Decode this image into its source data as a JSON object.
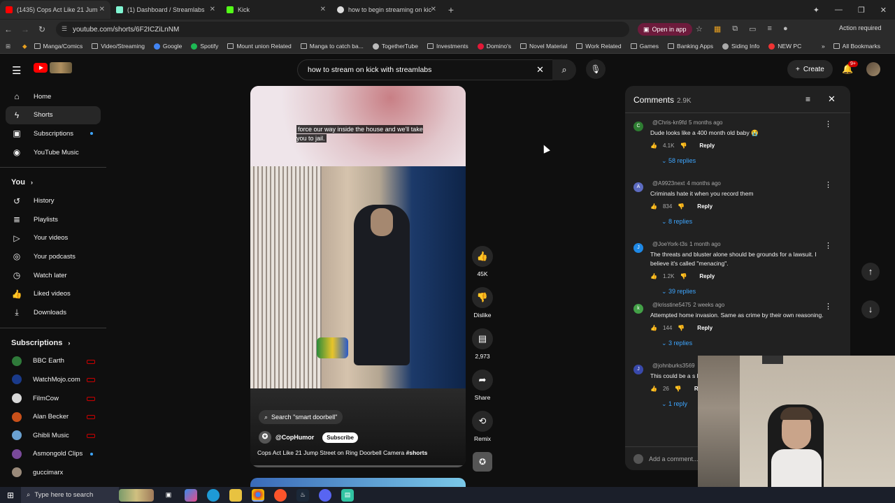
{
  "browser": {
    "tabs": [
      {
        "title": "(1435) Cops Act Like 21 Jum",
        "color": "#ff0000",
        "active": true
      },
      {
        "title": "(1) Dashboard / Streamlabs",
        "color": "#80f5d2",
        "active": false
      },
      {
        "title": "Kick",
        "color": "#53fc18",
        "active": false
      },
      {
        "title": "how to begin streaming on kic",
        "color": "#dddddd",
        "active": false
      }
    ],
    "url": "youtube.com/shorts/6F2ICZiLnNM",
    "open_in_app": "Open in app",
    "action_required": "Action required",
    "bookmarks": [
      {
        "label": "Manga/Comics",
        "icon": "folder-icon"
      },
      {
        "label": "Video/Streaming",
        "icon": "folder-icon"
      },
      {
        "label": "Google",
        "icon": "google-icon"
      },
      {
        "label": "Spotify",
        "icon": "spotify-icon"
      },
      {
        "label": "Mount union Related",
        "icon": "folder-icon"
      },
      {
        "label": "Manga to catch ba...",
        "icon": "folder-icon"
      },
      {
        "label": "TogetherTube",
        "icon": "togethertube-icon"
      },
      {
        "label": "Investments",
        "icon": "folder-icon"
      },
      {
        "label": "Domino's",
        "icon": "dominos-icon"
      },
      {
        "label": "Novel Material",
        "icon": "folder-icon"
      },
      {
        "label": "Work Related",
        "icon": "folder-icon"
      },
      {
        "label": "Games",
        "icon": "folder-icon"
      },
      {
        "label": "Banking Apps",
        "icon": "folder-icon"
      },
      {
        "label": "Siding Info",
        "icon": "globe-icon"
      },
      {
        "label": "NEW PC",
        "icon": "pc-icon"
      }
    ],
    "all_bookmarks": "All Bookmarks"
  },
  "youtube": {
    "search_query": "how to stream on kick with streamlabs",
    "create_label": "Create",
    "notification_badge": "9+",
    "sidebar": {
      "main": [
        {
          "label": "Home",
          "icon": "home-icon"
        },
        {
          "label": "Shorts",
          "icon": "shorts-icon",
          "active": true
        },
        {
          "label": "Subscriptions",
          "icon": "subscriptions-icon",
          "dot": true
        },
        {
          "label": "YouTube Music",
          "icon": "music-icon"
        }
      ],
      "you_heading": "You",
      "you": [
        {
          "label": "History",
          "icon": "history-icon"
        },
        {
          "label": "Playlists",
          "icon": "playlists-icon"
        },
        {
          "label": "Your videos",
          "icon": "your-videos-icon"
        },
        {
          "label": "Your podcasts",
          "icon": "podcasts-icon"
        },
        {
          "label": "Watch later",
          "icon": "watch-later-icon"
        },
        {
          "label": "Liked videos",
          "icon": "liked-icon"
        },
        {
          "label": "Downloads",
          "icon": "download-icon"
        }
      ],
      "subscriptions_heading": "Subscriptions",
      "subscriptions": [
        {
          "label": "BBC Earth",
          "color": "#2f7a3a",
          "live": true
        },
        {
          "label": "WatchMojo.com",
          "color": "#1a3a8a",
          "live": true
        },
        {
          "label": "FilmCow",
          "color": "#d8d8d8",
          "live": true
        },
        {
          "label": "Alan Becker",
          "color": "#c8501a",
          "live": true
        },
        {
          "label": "Ghibli Music",
          "color": "#6aa0d0",
          "live": true
        },
        {
          "label": "Asmongold Clips",
          "color": "#7a4a9a",
          "dot": true
        },
        {
          "label": "guccimarx",
          "color": "#9a8a7a"
        }
      ]
    },
    "short": {
      "caption": "force our way inside the house and we'll take you to jail.",
      "search_chip": "Search \"smart doorbell\"",
      "channel": "@CopHumor",
      "subscribe": "Subscribe",
      "title": "Cops Act Like 21 Jump Street on Ring Doorbell Camera",
      "hashtag": "#shorts",
      "actions": {
        "likes": "45K",
        "dislike": "Dislike",
        "comments": "2,973",
        "share": "Share",
        "remix": "Remix"
      }
    },
    "comments": {
      "title": "Comments",
      "count": "2.9K",
      "add_placeholder": "Add a comment...",
      "reply_label": "Reply",
      "items": [
        {
          "user": "@Chris-kn9fd",
          "time": "5 months ago",
          "text": "Dude looks like a 400 month old baby 😭",
          "likes": "4.1K",
          "replies": "58 replies",
          "avatar_letter": "C",
          "avatar_color": "#2e7d32"
        },
        {
          "user": "@A9923next",
          "time": "4 months ago",
          "text": "Criminals hate it when you record them",
          "likes": "834",
          "replies": "8 replies",
          "avatar_letter": "A",
          "avatar_color": "#5c6bc0"
        },
        {
          "user": "@JoeYork-t3s",
          "time": "1 month ago",
          "text": "The threats and bluster alone should be grounds for a lawsuit. I believe it's called \"menacing\".",
          "likes": "1.2K",
          "replies": "39 replies",
          "avatar_letter": "J",
          "avatar_color": "#1e88e5"
        },
        {
          "user": "@krisstine5475",
          "time": "2 weeks ago",
          "text": "Attempted home invasion. Same as crime by their own reasoning.",
          "likes": "144",
          "replies": "3 replies",
          "avatar_letter": "k",
          "avatar_color": "#43a047"
        },
        {
          "user": "@johnburks3569",
          "time": "",
          "text": "This could be a s hellscape versio",
          "likes": "26",
          "replies": "1 reply",
          "avatar_letter": "J",
          "avatar_color": "#3949ab"
        }
      ]
    }
  },
  "taskbar": {
    "search_placeholder": "Type here to search"
  }
}
